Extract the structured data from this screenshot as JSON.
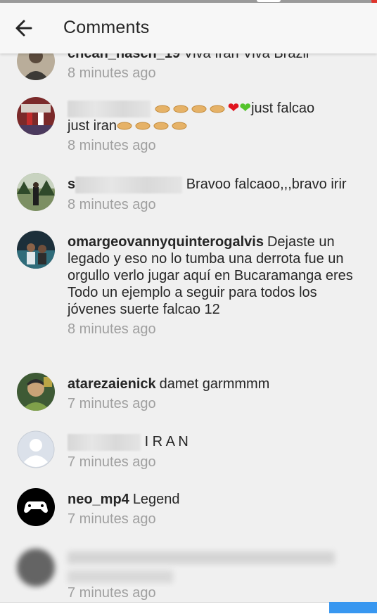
{
  "header": {
    "title": "Comments",
    "back_icon": "arrow-left-icon"
  },
  "comments": [
    {
      "user": "chcan_hasch_19",
      "text": "Viva Iran Viva Brazil",
      "time": "8 minutes ago"
    },
    {
      "user": "",
      "text_a": "",
      "text_b": "just falcao",
      "text_c": "just iran",
      "time": "8 minutes ago"
    },
    {
      "user_initial": "s",
      "text": "Bravoo falcaoo,,,bravo irir",
      "time": "8 minutes ago"
    },
    {
      "user": "omargeovannyquinterogalvis",
      "text": "Dejaste un legado y eso no lo tumba una derrota fue un orgullo verlo jugar aquí en Bucaramanga eres Todo un ejemplo a seguir para todos los jóvenes suerte falcao 12",
      "time": "8 minutes ago"
    },
    {
      "user": "atarezaienick",
      "text": "damet garmmmm",
      "time": "7 minutes ago"
    },
    {
      "user": "",
      "text": "I R A N",
      "time": "7 minutes ago"
    },
    {
      "user": "neo_mp4",
      "text": "Legend",
      "time": "7 minutes ago"
    },
    {
      "user": "",
      "text": "",
      "time": "7 minutes ago"
    }
  ],
  "colors": {
    "accent": "#3897f0",
    "heart": "#e0131d",
    "green_heart": "#53c32a"
  }
}
